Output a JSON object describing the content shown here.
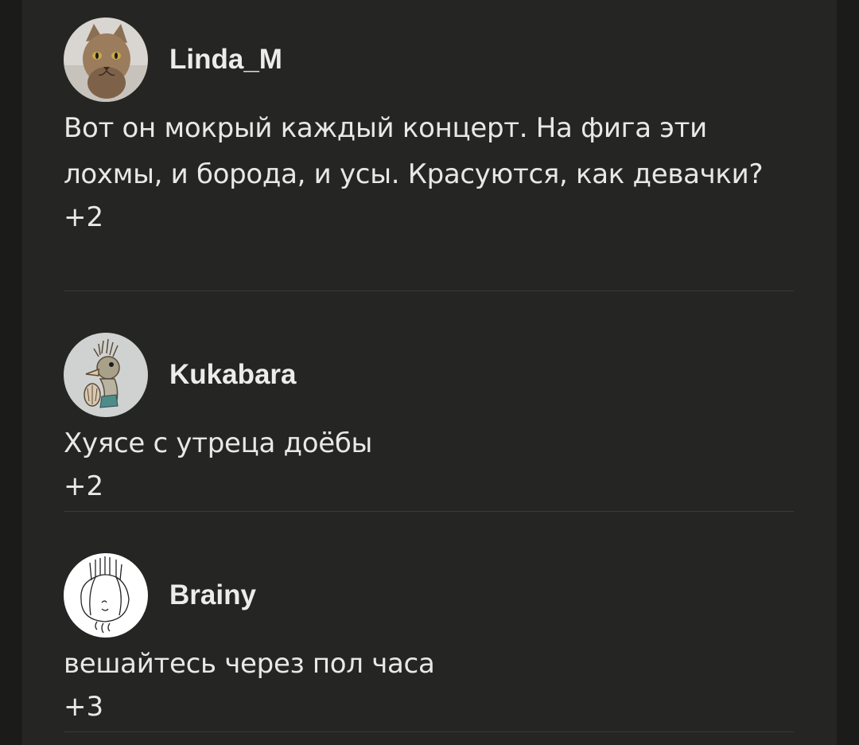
{
  "comments": [
    {
      "username": "Linda_M",
      "avatar": "cat-avatar",
      "text": "Вот он мокрый каждый концерт. На фига эти лохмы, и борода, и усы. Красуются, как девачки?",
      "rating": "+2"
    },
    {
      "username": "Kukabara",
      "avatar": "bird-drawing-avatar",
      "text": "Хуясе с утреца доёбы",
      "rating": "+2"
    },
    {
      "username": "Brainy",
      "avatar": "onion-doodle-avatar",
      "text": "вешайтесь через пол часа",
      "rating": "+3"
    }
  ],
  "colors": {
    "background": "#1b1c1a",
    "panel": "#252623",
    "text": "#e8e8e8",
    "divider": "#3a3b38"
  }
}
